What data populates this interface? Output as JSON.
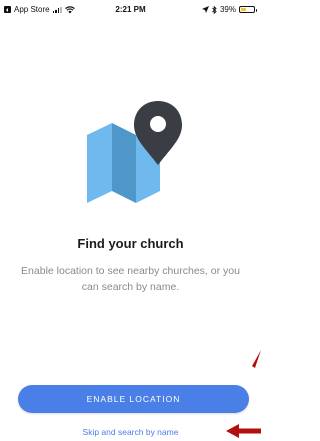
{
  "status_bar": {
    "back_label": "App Store",
    "time": "2:21 PM",
    "battery": "39%",
    "battery_level": 0.39
  },
  "main": {
    "heading": "Find your church",
    "description": "Enable location to see nearby churches, or you can search by name.",
    "illustration": "map-location-pin-icon"
  },
  "actions": {
    "enable_label": "ENABLE LOCATION",
    "skip_label": "Skip and search by name"
  },
  "colors": {
    "accent": "#4a7fe7",
    "map_light": "#6fb9ee",
    "map_dark": "#4f96c9",
    "pin": "#3a3d44",
    "annotation_arrow": "#b40f0f"
  }
}
